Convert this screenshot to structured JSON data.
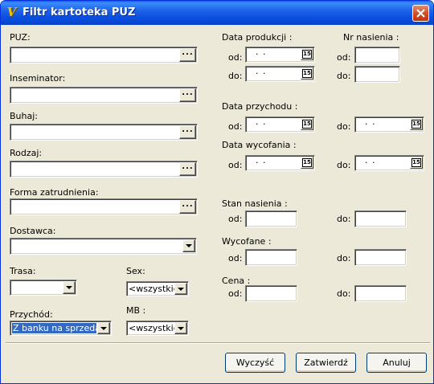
{
  "window": {
    "title": "Filtr kartoteka PUZ",
    "icon": "app-logo-icon"
  },
  "left": {
    "puz_label": "PUZ:",
    "puz_value": "",
    "inseminator_label": "Inseminator:",
    "inseminator_value": "",
    "buhaj_label": "Buhaj:",
    "buhaj_value": "",
    "rodzaj_label": "Rodzaj:",
    "rodzaj_value": "",
    "forma_label": "Forma zatrudnienia:",
    "forma_value": "",
    "dostawca_label": "Dostawca:",
    "dostawca_value": "",
    "trasa_label": "Trasa:",
    "trasa_value": "",
    "sex_label": "Sex:",
    "sex_value": "<wszystkie>",
    "przychod_label": "Przychód:",
    "przychod_value": "Z banku na sprzedaż",
    "mb_label": "MB :",
    "mb_value": "<wszystkie>",
    "ellipsis": "..."
  },
  "right": {
    "data_produkcji_label": "Data produkcji :",
    "nr_nasienia_label": "Nr nasienia :",
    "data_przychodu_label": "Data przychodu :",
    "data_wycofania_label": "Data wycofania :",
    "stan_nasienia_label": "Stan nasienia :",
    "wycofane_label": "Wycofane :",
    "cena_label": "Cena :",
    "od": "od:",
    "do": "do:",
    "empty_date": "· ·",
    "calendar_glyph": "15"
  },
  "buttons": {
    "clear": "Wyczyść",
    "confirm": "Zatwierdź",
    "cancel": "Anuluj"
  },
  "colors": {
    "title_bar": "#0a4ee0",
    "selection": "#316ac5",
    "window_bg": "#ece9d8"
  }
}
